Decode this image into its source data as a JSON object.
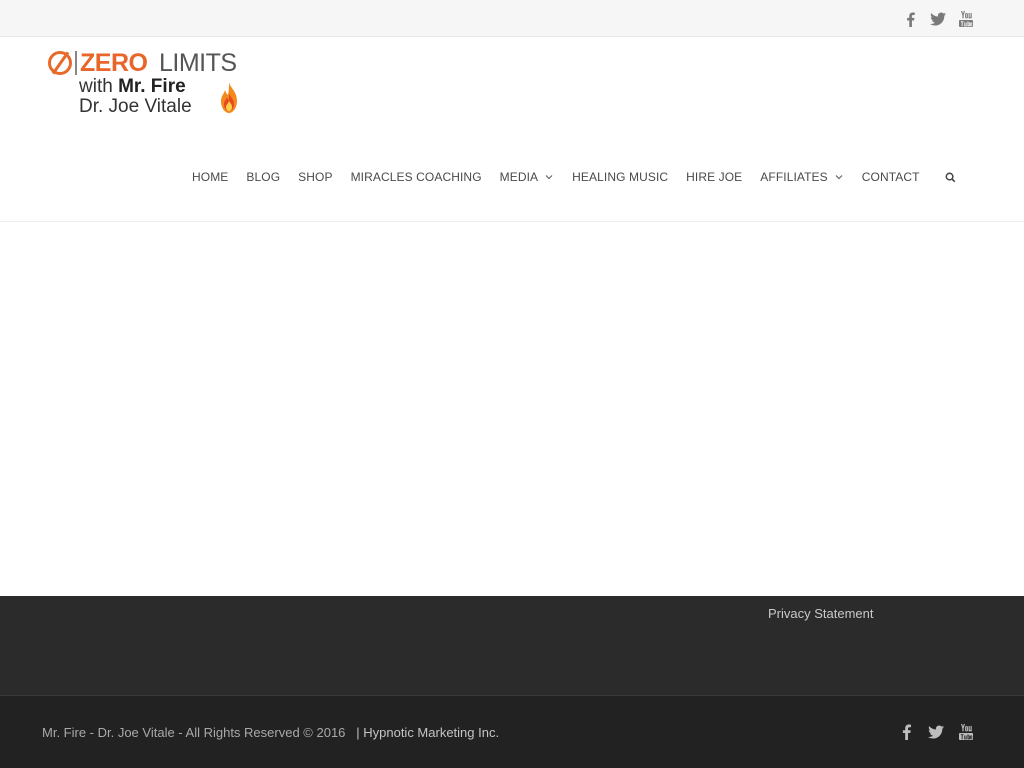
{
  "topbar": {
    "social": [
      {
        "icon": "facebook-icon"
      },
      {
        "icon": "twitter-icon"
      },
      {
        "icon": "youtube-icon"
      }
    ]
  },
  "logo": {
    "zero": "ZERO",
    "limits": "LIMITS",
    "with_prefix": "with ",
    "with_name": "Mr. Fire",
    "dr": "Dr. Joe Vitale",
    "accent": "#e8662a"
  },
  "nav": {
    "items": [
      {
        "label": "HOME"
      },
      {
        "label": "BLOG"
      },
      {
        "label": "SHOP"
      },
      {
        "label": "MIRACLES COACHING"
      },
      {
        "label": "MEDIA",
        "dropdown": true
      },
      {
        "label": "HEALING MUSIC"
      },
      {
        "label": "HIRE JOE"
      },
      {
        "label": "AFFILIATES",
        "dropdown": true
      },
      {
        "label": "CONTACT"
      }
    ],
    "search_icon": "search-icon"
  },
  "footer": {
    "privacy": "Privacy Statement",
    "copyright": "Mr. Fire - Dr. Joe Vitale - All Rights Reserved © 2016",
    "company": "| Hypnotic Marketing Inc.",
    "social": [
      {
        "icon": "facebook-icon"
      },
      {
        "icon": "twitter-icon"
      },
      {
        "icon": "youtube-icon"
      }
    ]
  }
}
